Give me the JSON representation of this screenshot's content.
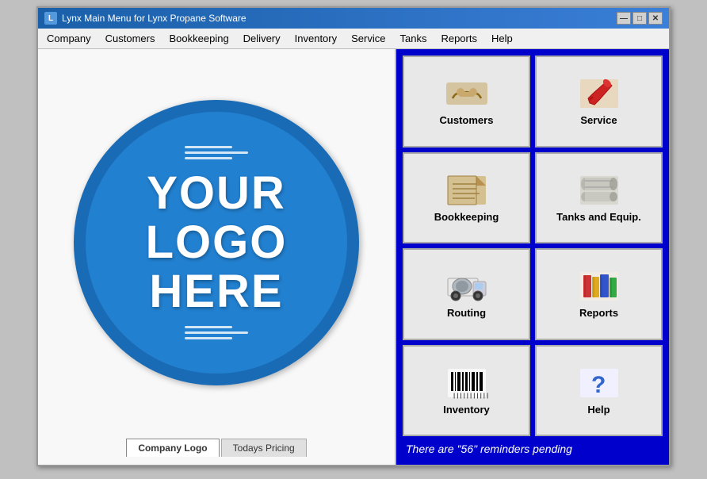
{
  "window": {
    "title": "Lynx Main Menu for Lynx Propane Software",
    "title_icon": "L"
  },
  "title_buttons": {
    "minimize": "—",
    "maximize": "□",
    "close": "✕"
  },
  "menu": {
    "items": [
      {
        "label": "Company"
      },
      {
        "label": "Customers"
      },
      {
        "label": "Bookkeeping"
      },
      {
        "label": "Delivery"
      },
      {
        "label": "Inventory"
      },
      {
        "label": "Service"
      },
      {
        "label": "Tanks"
      },
      {
        "label": "Reports"
      },
      {
        "label": "Help"
      }
    ]
  },
  "logo": {
    "line1": "YOUR",
    "line2": "LOGO",
    "line3": "HERE"
  },
  "bottom_tabs": [
    {
      "label": "Company Logo",
      "active": true
    },
    {
      "label": "Todays Pricing",
      "active": false
    }
  ],
  "buttons": [
    {
      "id": "customers",
      "label": "Customers",
      "icon": "handshake"
    },
    {
      "id": "service",
      "label": "Service",
      "icon": "wrench"
    },
    {
      "id": "bookkeeping",
      "label": "Bookkeeping",
      "icon": "papers"
    },
    {
      "id": "tanks",
      "label": "Tanks and Equip.",
      "icon": "tank"
    },
    {
      "id": "routing",
      "label": "Routing",
      "icon": "truck"
    },
    {
      "id": "reports",
      "label": "Reports",
      "icon": "books"
    },
    {
      "id": "inventory",
      "label": "Inventory",
      "icon": "barcode"
    },
    {
      "id": "help",
      "label": "Help",
      "icon": "question"
    }
  ],
  "reminders": {
    "text": "There are \"56\" reminders pending"
  },
  "colors": {
    "right_bg": "#0000cc",
    "logo_outer": "#1a6bb5",
    "logo_inner": "#2280d0"
  }
}
